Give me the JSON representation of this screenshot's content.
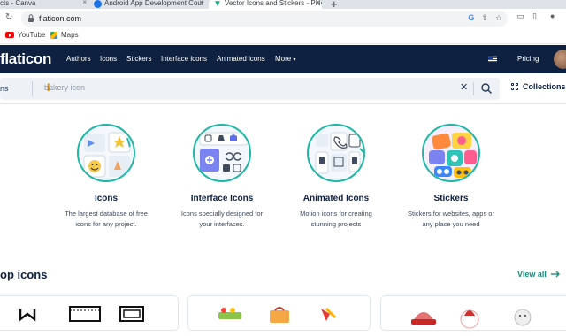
{
  "browser": {
    "tabs": [
      {
        "title": "cts - Canva"
      },
      {
        "title": "Android App Development Cour"
      },
      {
        "title": "Vector Icons and Stickers - PNG"
      }
    ],
    "url": "flaticon.com",
    "bookmarks": [
      {
        "label": "YouTube",
        "icon": "youtube-icon"
      },
      {
        "label": "Maps",
        "icon": "maps-icon"
      }
    ]
  },
  "site": {
    "logo": "flaticon",
    "nav": [
      "Authors",
      "Icons",
      "Stickers",
      "Interface icons",
      "Animated icons",
      "More"
    ],
    "pricing": "Pricing"
  },
  "search": {
    "type_label": "ns",
    "placeholder": "bakery icon",
    "collections_label": "Collections"
  },
  "categories": [
    {
      "title": "Icons",
      "desc1": "The largest database of free",
      "desc2": "icons for any project."
    },
    {
      "title": "Interface Icons",
      "desc1": "Icons specially designed for",
      "desc2": "your interfaces."
    },
    {
      "title": "Animated Icons",
      "desc1": "Motion icons for creating",
      "desc2": "stunning projects"
    },
    {
      "title": "Stickers",
      "desc1": "Stickers for websites, apps or",
      "desc2": "any place you need"
    }
  ],
  "top_icons": {
    "title": "op icons",
    "view_all": "View all"
  },
  "colors": {
    "nav_bg": "#0f2140",
    "accent": "#1fb6a6",
    "link": "#1b8a7a"
  }
}
